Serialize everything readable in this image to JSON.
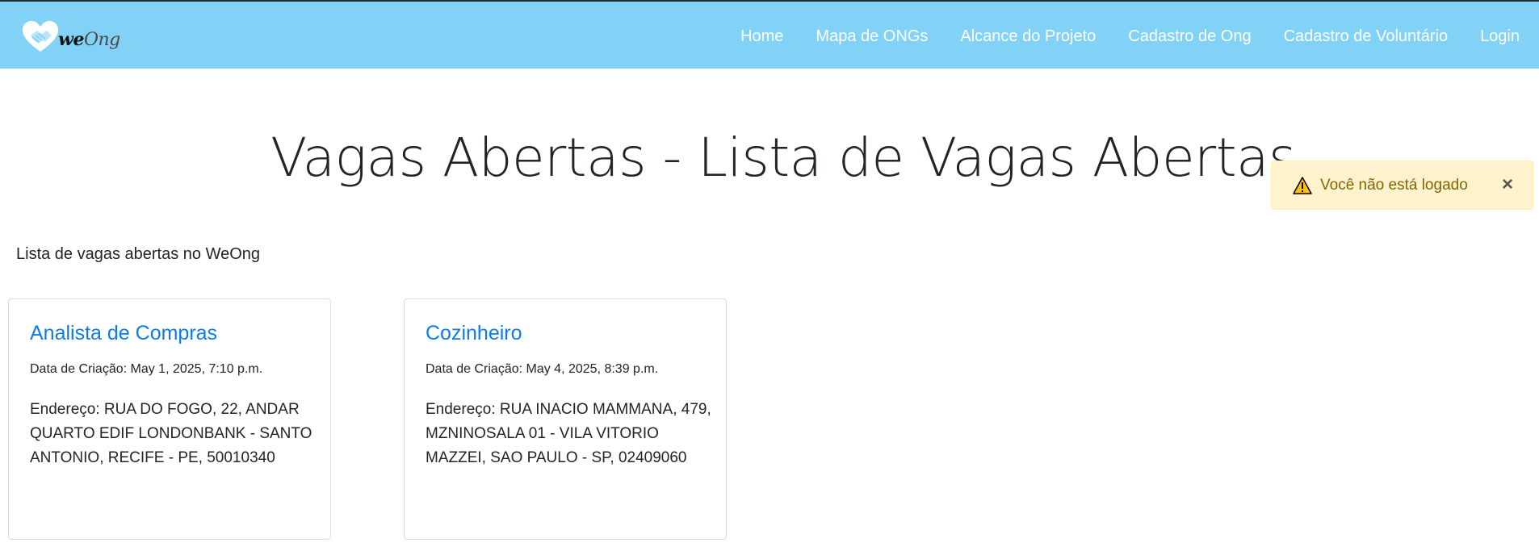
{
  "header": {
    "logo_text_a": "we",
    "logo_text_b": "Ong",
    "nav": [
      {
        "label": "Home"
      },
      {
        "label": "Mapa de ONGs"
      },
      {
        "label": "Alcance do Projeto"
      },
      {
        "label": "Cadastro de Ong"
      },
      {
        "label": "Cadastro de Voluntário"
      },
      {
        "label": "Login"
      }
    ],
    "bg_color": "#82d2f8"
  },
  "main": {
    "title": "Vagas Abertas - Lista de Vagas Abertas",
    "subtitle": "Lista de vagas abertas no WeOng"
  },
  "alert": {
    "icon": "warning-icon",
    "message": "Você não está logado",
    "close": "×"
  },
  "cards": [
    {
      "title": "Analista de Compras",
      "date": "Data de Criação: May 1, 2025, 7:10 p.m.",
      "address": "Endereço: RUA DO FOGO, 22, ANDAR QUARTO EDIF LONDONBANK - SANTO ANTONIO, RECIFE - PE, 50010340"
    },
    {
      "title": "Cozinheiro",
      "date": "Data de Criação: May 4, 2025, 8:39 p.m.",
      "address": "Endereço: RUA INACIO MAMMANA, 479, MZNINOSALA 01 - VILA VITORIO MAZZEI, SAO PAULO - SP, 02409060"
    }
  ]
}
